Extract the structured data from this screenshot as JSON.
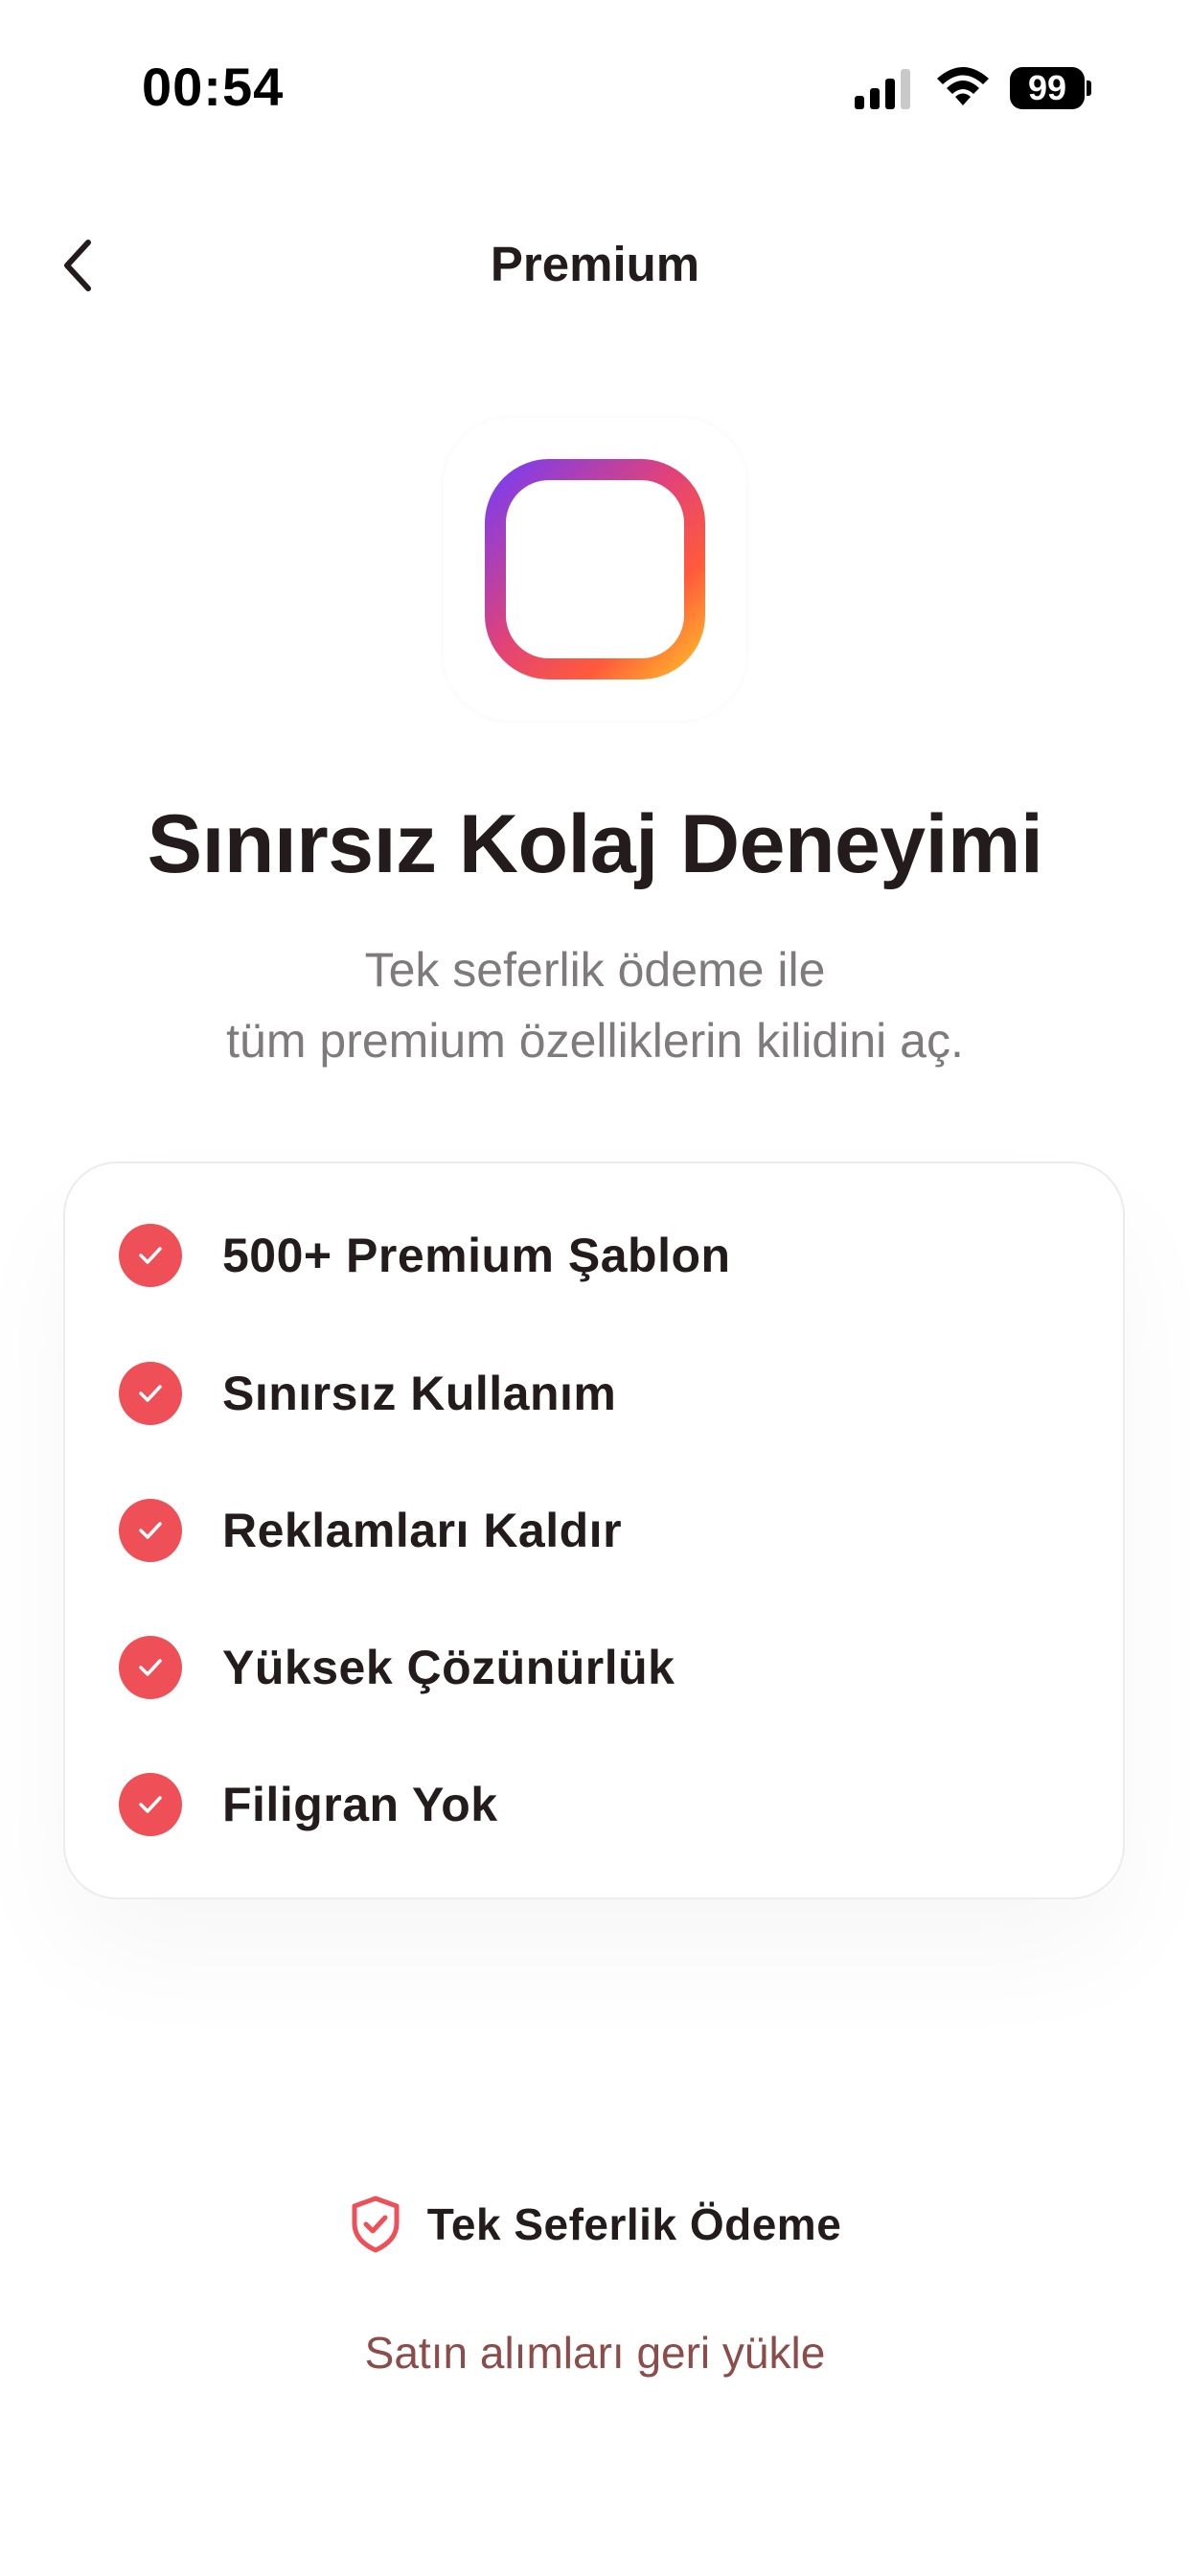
{
  "status_bar": {
    "time": "00:54",
    "battery": "99",
    "icons": [
      "cellular-signal-icon",
      "wifi-icon",
      "battery-icon"
    ]
  },
  "nav": {
    "back_icon": "chevron-left-icon",
    "title": "Premium"
  },
  "app_icon": {
    "icon": "collage-layout-icon",
    "gradient_colors": [
      "#7a3df0",
      "#e0427a",
      "#ff5a3c",
      "#ffb52a"
    ]
  },
  "hero": {
    "headline": "Sınırsız Kolaj Deneyimi",
    "subtitle_line1": "Tek seferlik ödeme ile",
    "subtitle_line2": "tüm premium özelliklerin kilidini aç."
  },
  "features": {
    "items": [
      {
        "label": "500+ Premium Şablon",
        "icon": "check-circle-icon"
      },
      {
        "label": "Sınırsız Kullanım",
        "icon": "check-circle-icon"
      },
      {
        "label": "Reklamları Kaldır",
        "icon": "check-circle-icon"
      },
      {
        "label": "Yüksek Çözünürlük",
        "icon": "check-circle-icon"
      },
      {
        "label": "Filigran Yok",
        "icon": "check-circle-icon"
      }
    ]
  },
  "footer": {
    "one_time_icon": "shield-check-icon",
    "one_time_label": "Tek Seferlik Ödeme",
    "restore_label": "Satın alımları geri yükle"
  },
  "colors": {
    "accent": "#ef4f57",
    "text_primary": "#231b1c",
    "text_secondary": "#7f7b7c",
    "link": "#8c4c4a"
  }
}
